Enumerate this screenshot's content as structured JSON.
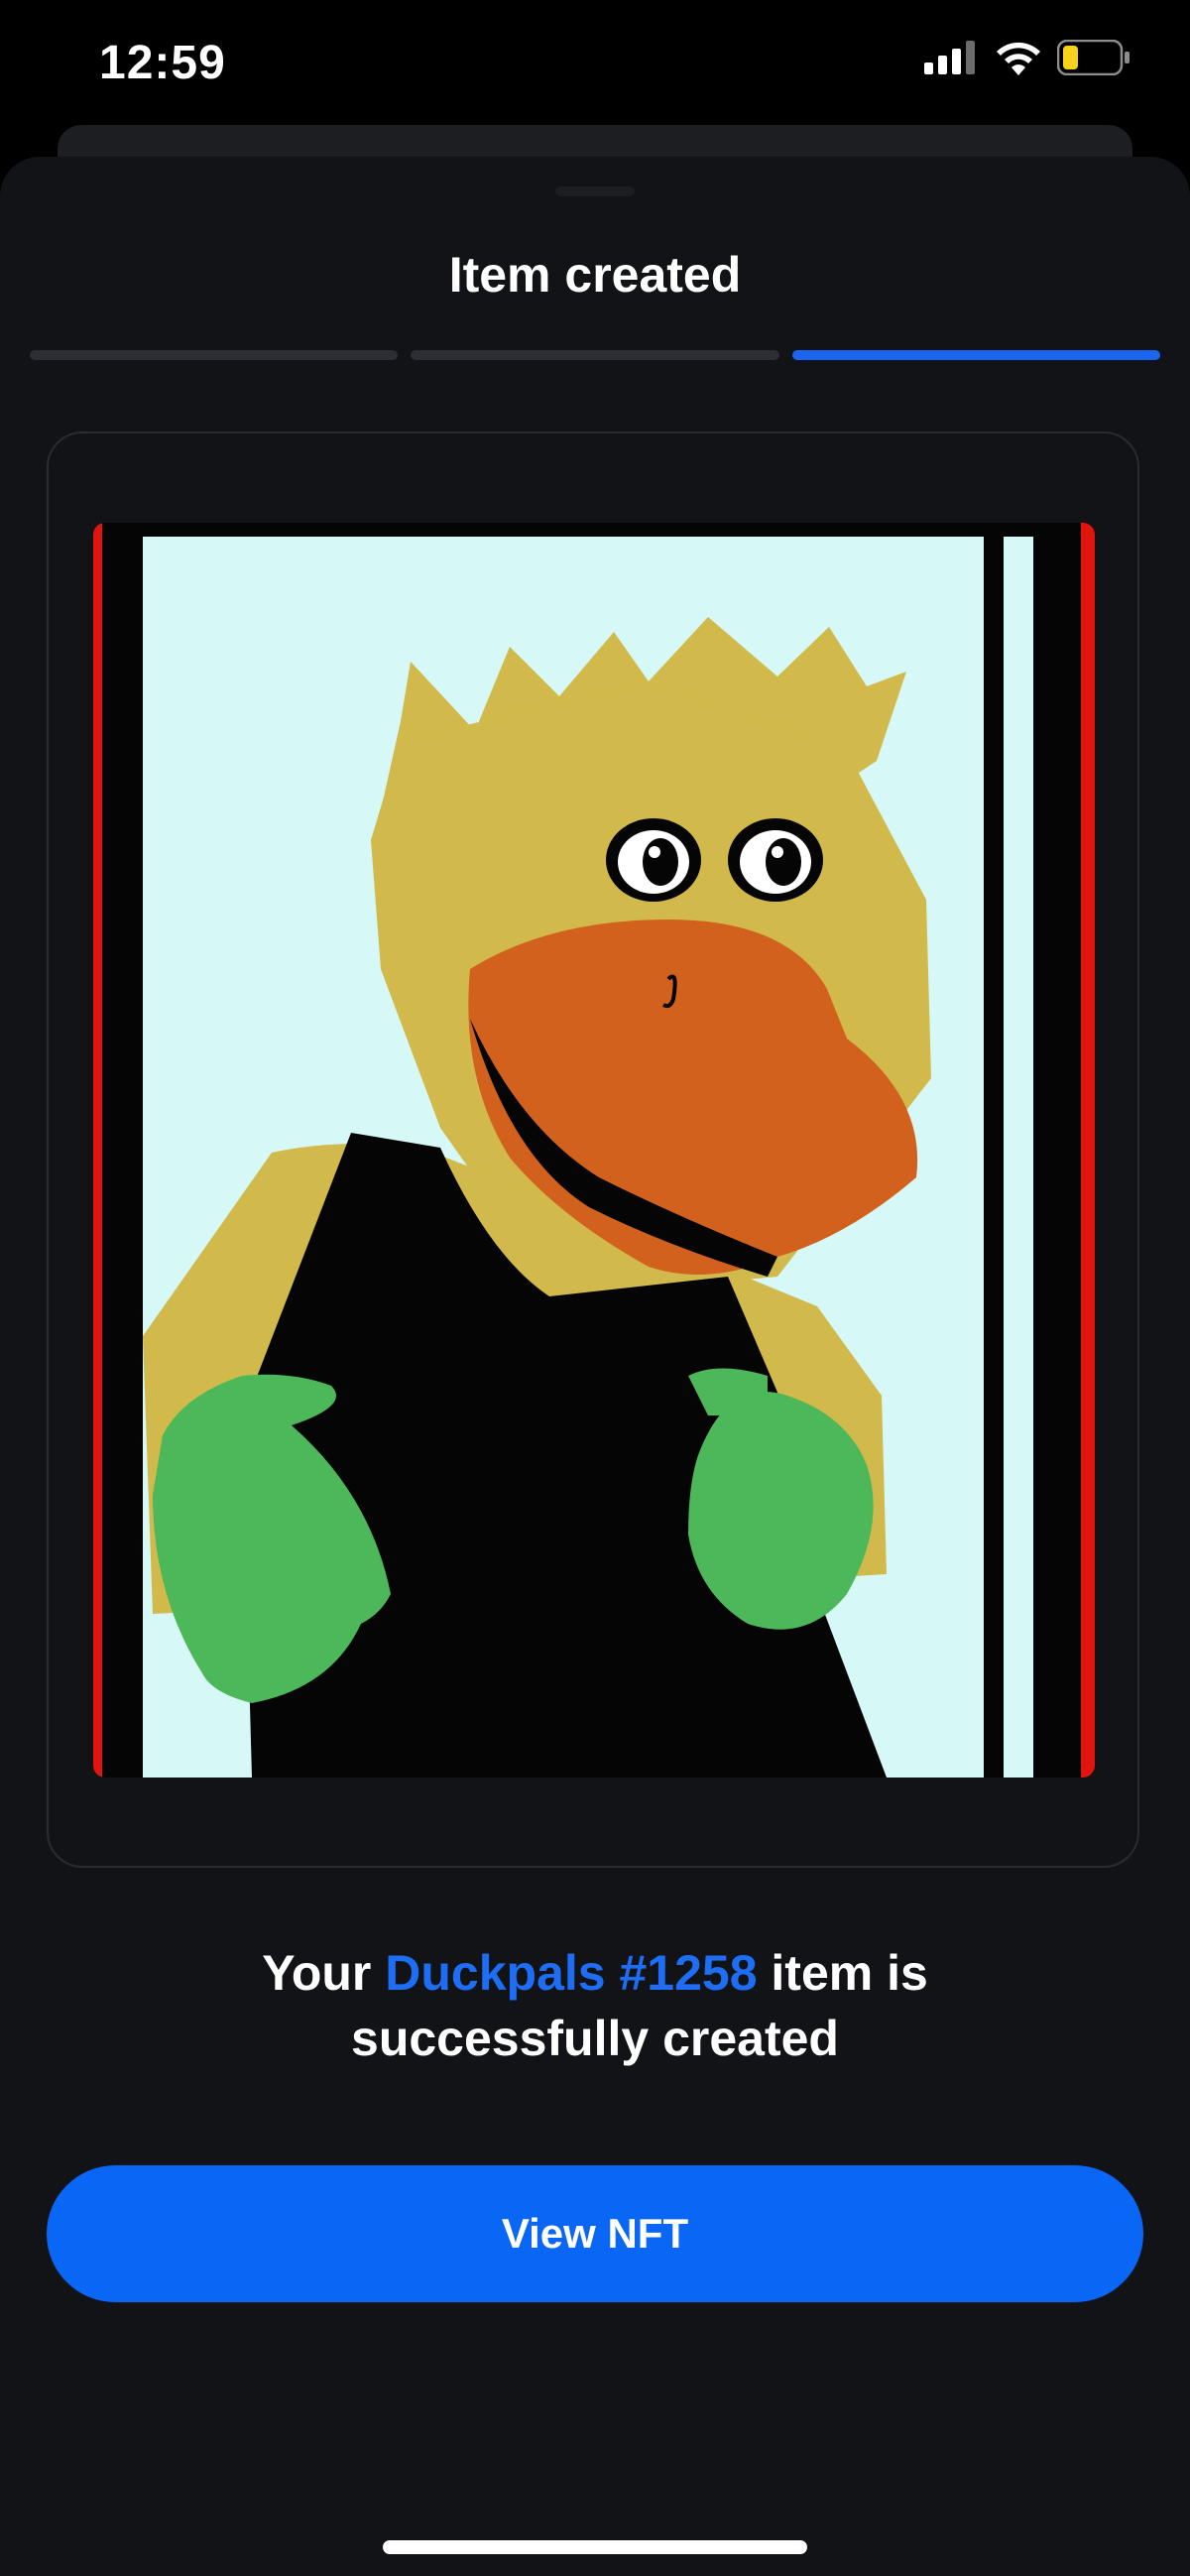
{
  "status_bar": {
    "time": "12:59",
    "icons": [
      "cellular-signal-icon",
      "wifi-icon",
      "battery-icon"
    ],
    "battery_color": "#f5d21c"
  },
  "sheet": {
    "title": "Item created",
    "progress_steps": 3,
    "active_step": 3
  },
  "nft": {
    "image_alt": "Duck character artwork",
    "collection": "Duckpals #1258"
  },
  "message": {
    "prefix": "Your ",
    "collection_link": "Duckpals #1258",
    "suffix": " item is",
    "line2": "successfully created"
  },
  "actions": {
    "view_nft_label": "View NFT"
  },
  "colors": {
    "accent": "#0a66f5",
    "background": "#121317"
  }
}
